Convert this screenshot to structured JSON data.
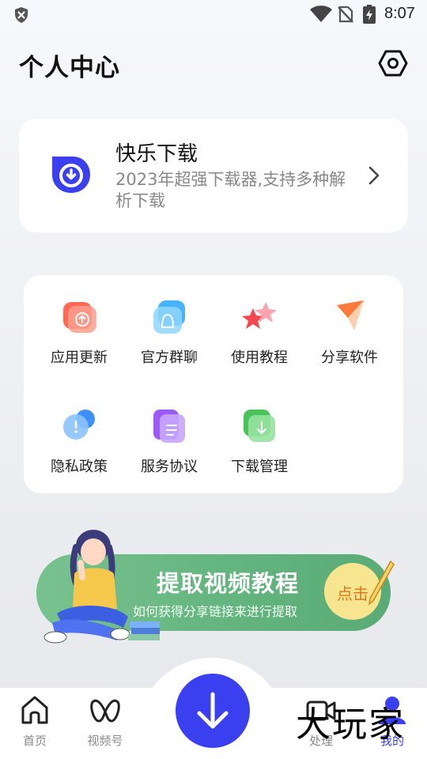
{
  "status_bar": {
    "time": "8:07",
    "icons": [
      "shield-icon",
      "wifi-icon",
      "no-sim-icon",
      "battery-charging-icon"
    ]
  },
  "header": {
    "title": "个人中心",
    "settings_icon": "hexagon-settings-icon"
  },
  "app_card": {
    "name": "快乐下载",
    "description": "2023年超强下载器,支持多种解析下载",
    "logo_color": "#3a3ff0"
  },
  "grid": {
    "items": [
      {
        "label": "应用更新",
        "icon": "update-icon",
        "color": "#ff6a55"
      },
      {
        "label": "官方群聊",
        "icon": "group-chat-icon",
        "color": "#47b3ff"
      },
      {
        "label": "使用教程",
        "icon": "star-icon",
        "color": "#f5474d"
      },
      {
        "label": "分享软件",
        "icon": "share-plane-icon",
        "color": "#ff8a3d"
      },
      {
        "label": "隐私政策",
        "icon": "privacy-icon",
        "color": "#3d8fff"
      },
      {
        "label": "服务协议",
        "icon": "agreement-icon",
        "color": "#9a5bf5"
      },
      {
        "label": "下载管理",
        "icon": "download-manage-icon",
        "color": "#49c35a"
      }
    ]
  },
  "banner": {
    "title": "提取视频教程",
    "subtitle": "如何获得分享链接来进行提取",
    "button": "点击"
  },
  "bottom_nav": {
    "items": [
      {
        "label": "首页",
        "icon": "home-icon"
      },
      {
        "label": "视频号",
        "icon": "video-channel-icon"
      },
      {
        "label": "处理",
        "icon": "video-camera-icon"
      },
      {
        "label": "我的",
        "icon": "profile-icon"
      }
    ],
    "fab_icon": "download-arrow-icon",
    "accent": "#3a3ff0"
  },
  "watermark": "大玩家"
}
